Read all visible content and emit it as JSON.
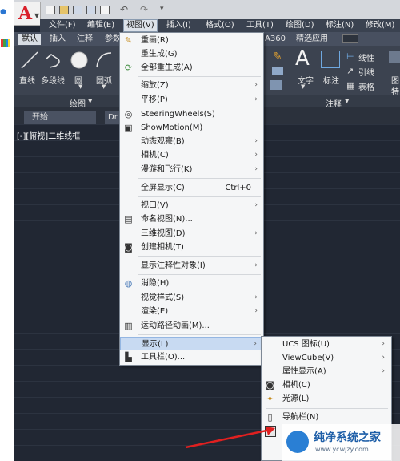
{
  "menubar": {
    "items": [
      "文件(F)",
      "编辑(E)",
      "视图(V)",
      "插入(I)",
      "格式(O)",
      "工具(T)",
      "绘图(D)",
      "标注(N)",
      "修改(M)"
    ]
  },
  "ribbon": {
    "tabs": [
      "默认",
      "插入",
      "注释",
      "参数",
      "A360",
      "精选应用"
    ],
    "draw_tools": [
      "直线",
      "多段线",
      "圆",
      "圆弧"
    ],
    "draw_panel": "绘图",
    "annot_tools": [
      "文字",
      "标注"
    ],
    "annot_small": [
      "线性",
      "引线",
      "表格"
    ],
    "annot_panel": "注释",
    "right_partial": [
      "图",
      "特"
    ]
  },
  "doc_tabs": [
    "开始",
    "Dr"
  ],
  "viewport_label": "[-][俯视]二维线框",
  "view_menu": {
    "items": [
      {
        "label": "重画(R)",
        "icon": "pencil-icon"
      },
      {
        "label": "重生成(G)"
      },
      {
        "label": "全部重生成(A)",
        "icon": "regen-all-icon"
      },
      {
        "label": "缩放(Z)",
        "submenu": true
      },
      {
        "label": "平移(P)",
        "submenu": true
      },
      {
        "label": "SteeringWheels(S)",
        "icon": "steeringwheel-icon"
      },
      {
        "label": "ShowMotion(M)",
        "icon": "showmotion-icon"
      },
      {
        "label": "动态观察(B)",
        "submenu": true
      },
      {
        "label": "相机(C)",
        "submenu": true
      },
      {
        "label": "漫游和飞行(K)",
        "submenu": true
      },
      {
        "label": "全屏显示(C)",
        "shortcut": "Ctrl+0"
      },
      {
        "label": "视口(V)",
        "submenu": true
      },
      {
        "label": "命名视图(N)...",
        "icon": "named-view-icon"
      },
      {
        "label": "三维视图(D)",
        "submenu": true
      },
      {
        "label": "创建相机(T)",
        "icon": "camera-icon"
      },
      {
        "label": "显示注释性对象(I)",
        "submenu": true
      },
      {
        "label": "消隐(H)",
        "icon": "hide-icon"
      },
      {
        "label": "视觉样式(S)",
        "submenu": true
      },
      {
        "label": "渲染(E)",
        "submenu": true
      },
      {
        "label": "运动路径动画(M)...",
        "icon": "motion-path-icon"
      },
      {
        "label": "显示(L)",
        "submenu": true,
        "highlighted": true
      },
      {
        "label": "工具栏(O)...",
        "icon": "toolbar-icon"
      }
    ]
  },
  "display_submenu": {
    "items": [
      {
        "label": "UCS 图标(U)",
        "submenu": true
      },
      {
        "label": "ViewCube(V)",
        "submenu": true
      },
      {
        "label": "属性显示(A)",
        "submenu": true
      },
      {
        "label": "相机(C)",
        "icon": "camera-icon"
      },
      {
        "label": "光源(L)",
        "icon": "light-icon"
      },
      {
        "label": "导航栏(N)",
        "icon": "navbar-icon"
      }
    ]
  },
  "watermark": {
    "text": "纯净系统之家",
    "url": "www.ycwjzy.com"
  },
  "colors": {
    "accent_red": "#d9202a",
    "highlight": "#c8daf2",
    "canvas": "#212733"
  }
}
